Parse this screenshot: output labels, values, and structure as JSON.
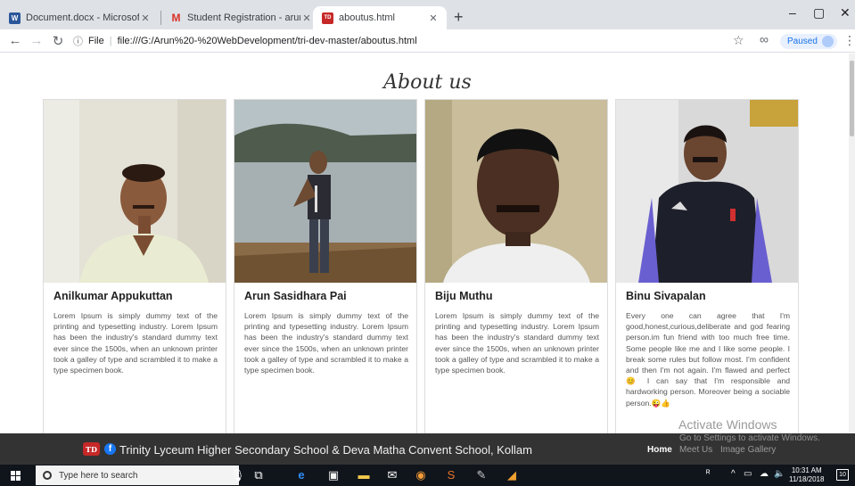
{
  "browser": {
    "tabs": [
      {
        "title": "Document.docx - Microsoft Wor",
        "icon": "word-icon",
        "color": "#2b579a",
        "glyph": "W"
      },
      {
        "title": "Student Registration - arunpared",
        "icon": "gmail-icon",
        "color": "#d93025",
        "glyph": "M"
      },
      {
        "title": "aboutus.html",
        "icon": "td-icon",
        "color": "#c62828",
        "glyph": "TD"
      }
    ],
    "address": {
      "scheme_label": "File",
      "url": "file:///G:/Arun%20-%20WebDevelopment/tri-dev-master/aboutus.html"
    },
    "profile_status": "Paused"
  },
  "page": {
    "title": "About us",
    "members": [
      {
        "name": "Anilkumar Appukuttan",
        "bio": "Lorem Ipsum is simply dummy text of the printing and typesetting industry. Lorem Ipsum has been the industry's standard dummy text ever since the 1500s, when an unknown printer took a galley of type and scrambled it to make a type specimen book."
      },
      {
        "name": "Arun Sasidhara Pai",
        "bio": "Lorem Ipsum is simply dummy text of the printing and typesetting industry. Lorem Ipsum has been the industry's standard dummy text ever since the 1500s, when an unknown printer took a galley of type and scrambled it to make a type specimen book."
      },
      {
        "name": "Biju Muthu",
        "bio": "Lorem Ipsum is simply dummy text of the printing and typesetting industry. Lorem Ipsum has been the industry's standard dummy text ever since the 1500s, when an unknown printer took a galley of type and scrambled it to make a type specimen book."
      },
      {
        "name": "Binu Sivapalan",
        "bio": "Every one can agree that I'm good,honest,curious,deliberate and god fearing person.im fun friend with too much free time. Some people like me and I like some people. I break some rules but follow most. I'm confident and then I'm not again. I'm flawed and perfect 😊 I can say that I'm responsible and hardworking person. Moreover being a sociable person.😜👍"
      }
    ]
  },
  "watermark": {
    "line1": "Activate Windows",
    "line2": "Go to Settings to activate Windows."
  },
  "footer": {
    "logo_text": "TD",
    "fb_glyph": "f",
    "school_name": "Trinity Lyceum Higher Secondary School & Deva Matha Convent School, Kollam",
    "nav": [
      "Home",
      "Meet Us",
      "Image Gallery"
    ]
  },
  "taskbar": {
    "search_placeholder": "Type here to search",
    "time": "10:31 AM",
    "date": "11/18/2018",
    "notifications": "10"
  }
}
